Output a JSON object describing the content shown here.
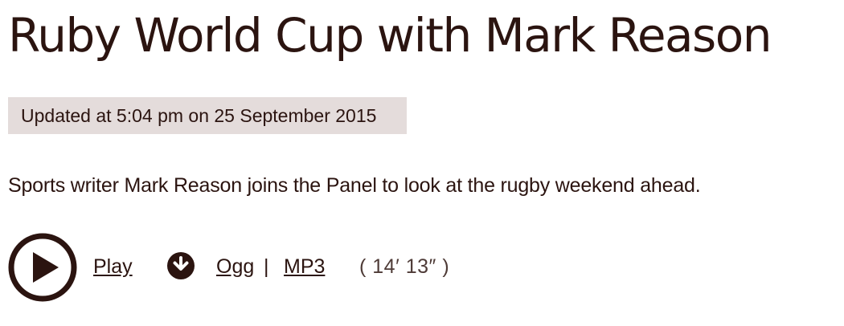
{
  "article": {
    "title": "Ruby World Cup with Mark Reason",
    "updated": "Updated at 5:04 pm on 25 September 2015",
    "summary": "Sports writer Mark Reason joins the Panel to look at the rugby weekend ahead."
  },
  "player": {
    "play_label": "Play",
    "ogg_label": "Ogg",
    "separator": "|",
    "mp3_label": "MP3",
    "duration": "( 14′ 13″ )"
  },
  "icons": {
    "play": "play-circle-icon",
    "download": "download-icon"
  },
  "colors": {
    "text": "#2b1410",
    "timestamp_background": "#e4dcdb"
  }
}
